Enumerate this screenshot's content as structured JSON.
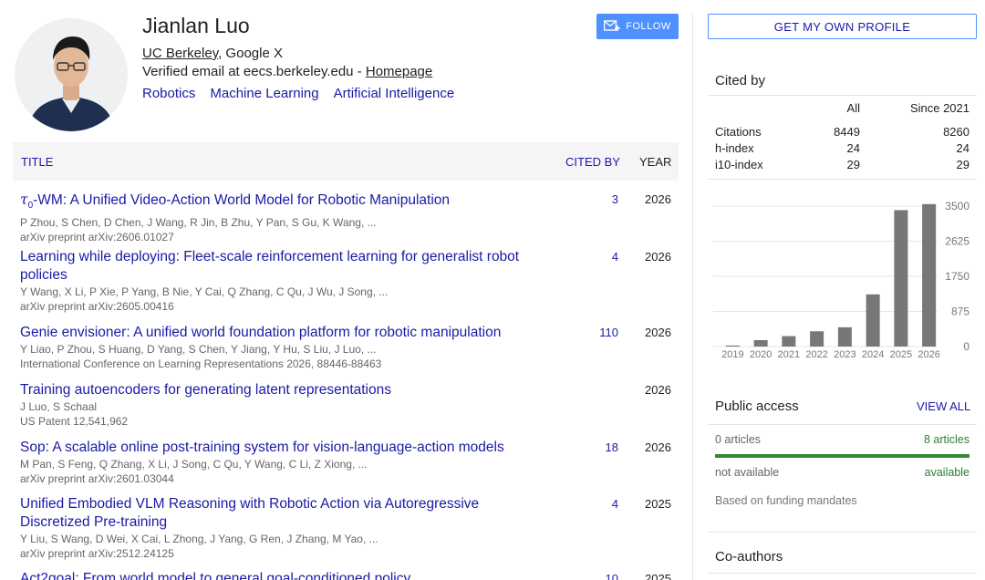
{
  "profile": {
    "name": "Jianlan Luo",
    "affiliation_link": "UC Berkeley",
    "affiliation_rest": ", Google X",
    "email_text": "Verified email at eecs.berkeley.edu - ",
    "homepage_link": "Homepage",
    "interests": [
      "Robotics",
      "Machine Learning",
      "Artificial Intelligence"
    ]
  },
  "buttons": {
    "follow": "FOLLOW",
    "get_profile": "GET MY OWN PROFILE"
  },
  "table": {
    "col_title": "TITLE",
    "col_cited": "CITED BY",
    "col_year": "YEAR"
  },
  "papers": [
    {
      "title_prefix": "τ",
      "title_sub": "0",
      "title": "-WM: A Unified Video-Action World Model for Robotic Manipulation",
      "authors": "P Zhou, S Chen, D Chen, J Wang, R Jin, B Zhu, Y Pan, S Gu, K Wang, ...",
      "venue": "arXiv preprint arXiv:2606.01027",
      "cited": "3",
      "year": "2026"
    },
    {
      "title": "Learning while deploying: Fleet-scale reinforcement learning for generalist robot policies",
      "authors": "Y Wang, X Li, P Xie, P Yang, B Nie, Y Cai, Q Zhang, C Qu, J Wu, J Song, ...",
      "venue": "arXiv preprint arXiv:2605.00416",
      "cited": "4",
      "year": "2026"
    },
    {
      "title": "Genie envisioner: A unified world foundation platform for robotic manipulation",
      "authors": "Y Liao, P Zhou, S Huang, D Yang, S Chen, Y Jiang, Y Hu, S Liu, J Luo, ...",
      "venue": "International Conference on Learning Representations 2026, 88446-88463",
      "cited": "110",
      "year": "2026"
    },
    {
      "title": "Training autoencoders for generating latent representations",
      "authors": "J Luo, S Schaal",
      "venue": "US Patent 12,541,962",
      "cited": "",
      "year": "2026"
    },
    {
      "title": "Sop: A scalable online post-training system for vision-language-action models",
      "authors": "M Pan, S Feng, Q Zhang, X Li, J Song, C Qu, Y Wang, C Li, Z Xiong, ...",
      "venue": "arXiv preprint arXiv:2601.03044",
      "cited": "18",
      "year": "2026"
    },
    {
      "title": "Unified Embodied VLM Reasoning with Robotic Action via Autoregressive Discretized Pre-training",
      "authors": "Y Liu, S Wang, D Wei, X Cai, L Zhong, J Yang, G Ren, J Zhang, M Yao, ...",
      "venue": "arXiv preprint arXiv:2512.24125",
      "cited": "4",
      "year": "2025"
    },
    {
      "title": "Act2goal: From world model to general goal-conditioned policy",
      "authors": "",
      "venue": "",
      "cited": "10",
      "year": "2025"
    }
  ],
  "cited_by": {
    "title": "Cited by",
    "col_all": "All",
    "col_since": "Since 2021",
    "rows": [
      {
        "label": "Citations",
        "all": "8449",
        "since": "8260"
      },
      {
        "label": "h-index",
        "all": "24",
        "since": "24"
      },
      {
        "label": "i10-index",
        "all": "29",
        "since": "29"
      }
    ]
  },
  "chart_data": {
    "type": "bar",
    "categories": [
      "2019",
      "2020",
      "2021",
      "2022",
      "2023",
      "2024",
      "2025",
      "2026"
    ],
    "values": [
      25,
      160,
      260,
      380,
      480,
      1300,
      3400,
      3550
    ],
    "ylim": [
      0,
      3500
    ],
    "yticks": [
      "0",
      "875",
      "1750",
      "2625",
      "3500"
    ],
    "bar_color": "#777777",
    "grid": true
  },
  "public_access": {
    "title": "Public access",
    "view_all": "VIEW ALL",
    "left_count": "0 articles",
    "right_count": "8 articles",
    "left_status": "not available",
    "right_status": "available",
    "note": "Based on funding mandates",
    "available_fraction": 1.0
  },
  "coauthors": {
    "title": "Co-authors"
  }
}
